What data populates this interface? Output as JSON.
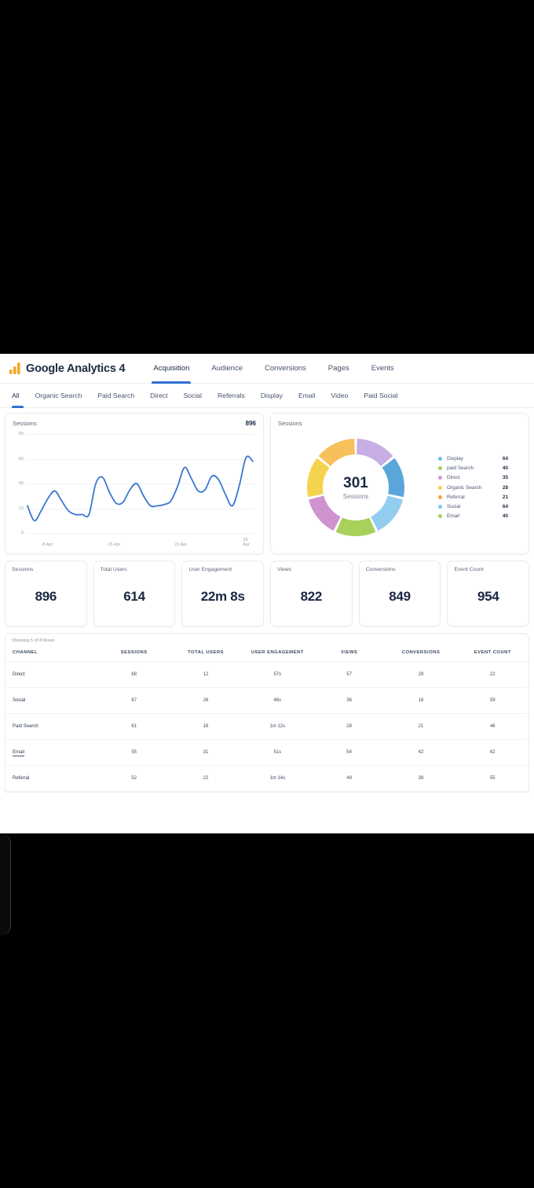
{
  "app": {
    "brand": "Google Analytics 4",
    "logo_icon": "google-analytics-bars-icon"
  },
  "nav": {
    "tabs": [
      {
        "label": "Acquisition",
        "active": true
      },
      {
        "label": "Audience",
        "active": false
      },
      {
        "label": "Conversions",
        "active": false
      },
      {
        "label": "Pages",
        "active": false
      },
      {
        "label": "Events",
        "active": false
      }
    ]
  },
  "filters": {
    "items": [
      {
        "label": "All",
        "active": true
      },
      {
        "label": "Organic Search",
        "active": false
      },
      {
        "label": "Paid Search",
        "active": false
      },
      {
        "label": "Direct",
        "active": false
      },
      {
        "label": "Social",
        "active": false
      },
      {
        "label": "Referrals",
        "active": false
      },
      {
        "label": "Display",
        "active": false
      },
      {
        "label": "Email",
        "active": false
      },
      {
        "label": "Video",
        "active": false
      },
      {
        "label": "Paid Social",
        "active": false
      }
    ]
  },
  "line_card": {
    "title": "Sessions",
    "total": "896"
  },
  "donut_card": {
    "title": "Sessions",
    "center_value": "301",
    "center_label": "Sessions"
  },
  "kpis": [
    {
      "label": "Sessions",
      "value": "896"
    },
    {
      "label": "Total Users",
      "value": "614"
    },
    {
      "label": "User Engagement",
      "value": "22m 8s"
    },
    {
      "label": "Views",
      "value": "822"
    },
    {
      "label": "Conversions",
      "value": "849"
    },
    {
      "label": "Event Count",
      "value": "954"
    }
  ],
  "table": {
    "meta": "Showing 5 of 8 Rows",
    "columns": [
      "CHANNEL",
      "SESSIONS",
      "TOTAL USERS",
      "USER ENGAGEMENT",
      "VIEWS",
      "CONVERSIONS",
      "EVENT COUNT"
    ],
    "rows": [
      {
        "channel": "Direct",
        "sessions": "68",
        "total_users": "12",
        "user_engagement": "57s",
        "views": "57",
        "conversions": "29",
        "event_count": "22",
        "link": false
      },
      {
        "channel": "Social",
        "sessions": "67",
        "total_users": "26",
        "user_engagement": "46s",
        "views": "36",
        "conversions": "18",
        "event_count": "59",
        "link": false
      },
      {
        "channel": "Paid Search",
        "sessions": "61",
        "total_users": "18",
        "user_engagement": "1m 12s",
        "views": "28",
        "conversions": "21",
        "event_count": "46",
        "link": false
      },
      {
        "channel": "Email",
        "sessions": "55",
        "total_users": "31",
        "user_engagement": "51s",
        "views": "54",
        "conversions": "42",
        "event_count": "62",
        "link": true
      },
      {
        "channel": "Referral",
        "sessions": "52",
        "total_users": "22",
        "user_engagement": "1m 14s",
        "views": "49",
        "conversions": "38",
        "event_count": "55",
        "link": false
      }
    ]
  },
  "chart_data": [
    {
      "type": "line",
      "title": "Sessions",
      "total": 896,
      "xlabel": "",
      "ylabel": "",
      "ylim": [
        0,
        80
      ],
      "yticks": [
        0,
        20,
        40,
        60,
        80
      ],
      "xticks": [
        "8 Apr",
        "15 Apr",
        "22 Apr",
        "29 Apr"
      ],
      "grid": true,
      "line_color": "#3b76d0",
      "x": [
        1,
        2,
        3,
        4,
        5,
        6,
        7,
        8,
        9,
        10,
        11,
        12,
        13,
        14,
        15,
        16,
        17,
        18,
        19,
        20,
        21,
        22,
        23,
        24,
        25,
        26,
        27,
        28,
        29,
        30,
        31,
        32,
        33,
        34
      ],
      "values": [
        22,
        10,
        18,
        28,
        34,
        26,
        18,
        15,
        15,
        15,
        40,
        45,
        33,
        24,
        25,
        35,
        40,
        30,
        22,
        22,
        23,
        26,
        38,
        53,
        44,
        34,
        35,
        46,
        43,
        31,
        22,
        38,
        61,
        58
      ]
    },
    {
      "type": "pie",
      "title": "Sessions",
      "center_value": 301,
      "center_label": "Sessions",
      "legend_position": "right",
      "categories": [
        "Display",
        "paid Search",
        "Direct",
        "Organic Search",
        "Referral",
        "Social",
        "Email"
      ],
      "values": [
        64,
        40,
        35,
        28,
        21,
        64,
        40
      ],
      "colors": [
        "#5fc2e8",
        "#a8d05a",
        "#dd8fd0",
        "#f5cf4e",
        "#f5a742",
        "#7cc6ee",
        "#a8d05a"
      ],
      "segment_colors_clockwise": [
        "#c7aee4",
        "#5aa6d8",
        "#92cdf0",
        "#a8d05a",
        "#cf94cf",
        "#f5d34e",
        "#f7c05a"
      ]
    }
  ]
}
